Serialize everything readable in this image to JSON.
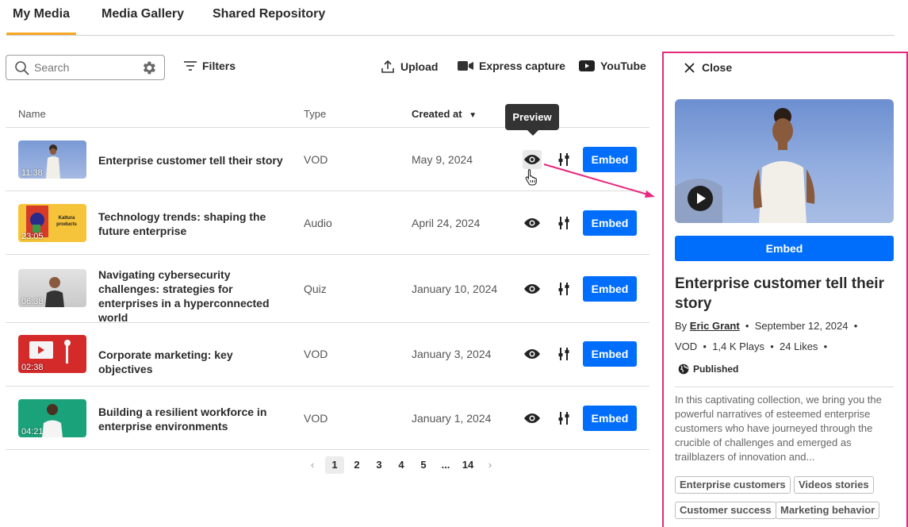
{
  "tabs": [
    "My Media",
    "Media Gallery",
    "Shared Repository"
  ],
  "toolbar": {
    "search_placeholder": "Search",
    "filters_label": "Filters",
    "upload_label": "Upload",
    "express_label": "Express capture",
    "youtube_label": "YouTube"
  },
  "table": {
    "headers": {
      "name": "Name",
      "type": "Type",
      "created": "Created at"
    },
    "embed_label": "Embed",
    "rows": [
      {
        "title": "Enterprise customer tell their story",
        "type": "VOD",
        "date": "May 9, 2024",
        "duration": "11:38"
      },
      {
        "title": "Technology trends: shaping the future enterprise",
        "type": "Audio",
        "date": "April 24, 2024",
        "duration": "23:05",
        "thumb_text": "Kaltura products"
      },
      {
        "title": "Navigating cybersecurity challenges: strategies for enterprises in a hyperconnected world",
        "type": "Quiz",
        "date": "January 10, 2024",
        "duration": "06:38"
      },
      {
        "title": "Corporate marketing: key objectives",
        "type": "VOD",
        "date": "January 3, 2024",
        "duration": "02:38"
      },
      {
        "title": "Building a resilient workforce in enterprise environments",
        "type": "VOD",
        "date": "January 1, 2024",
        "duration": "04:21"
      }
    ]
  },
  "tooltip": "Preview",
  "pagination": {
    "pages": [
      "1",
      "2",
      "3",
      "4",
      "5",
      "...",
      "14"
    ],
    "current": "1"
  },
  "panel": {
    "close_label": "Close",
    "embed_label": "Embed",
    "title": "Enterprise customer tell their story",
    "by_label": "By",
    "author": "Eric Grant",
    "date": "September 12, 2024",
    "type": "VOD",
    "plays": "1,4 K Plays",
    "likes": "24 Likes",
    "status": "Published",
    "description": "In this captivating collection, we bring you the powerful narratives of esteemed enterprise customers who have journeyed through the crucible of challenges and emerged as trailblazers of innovation and...",
    "tags": [
      "Enterprise customers",
      "Videos stories",
      "Customer success",
      "Marketing behavior"
    ]
  },
  "colors": {
    "accent": "#006efa",
    "tab_underline": "#f5a623",
    "highlight": "#e6287e"
  }
}
